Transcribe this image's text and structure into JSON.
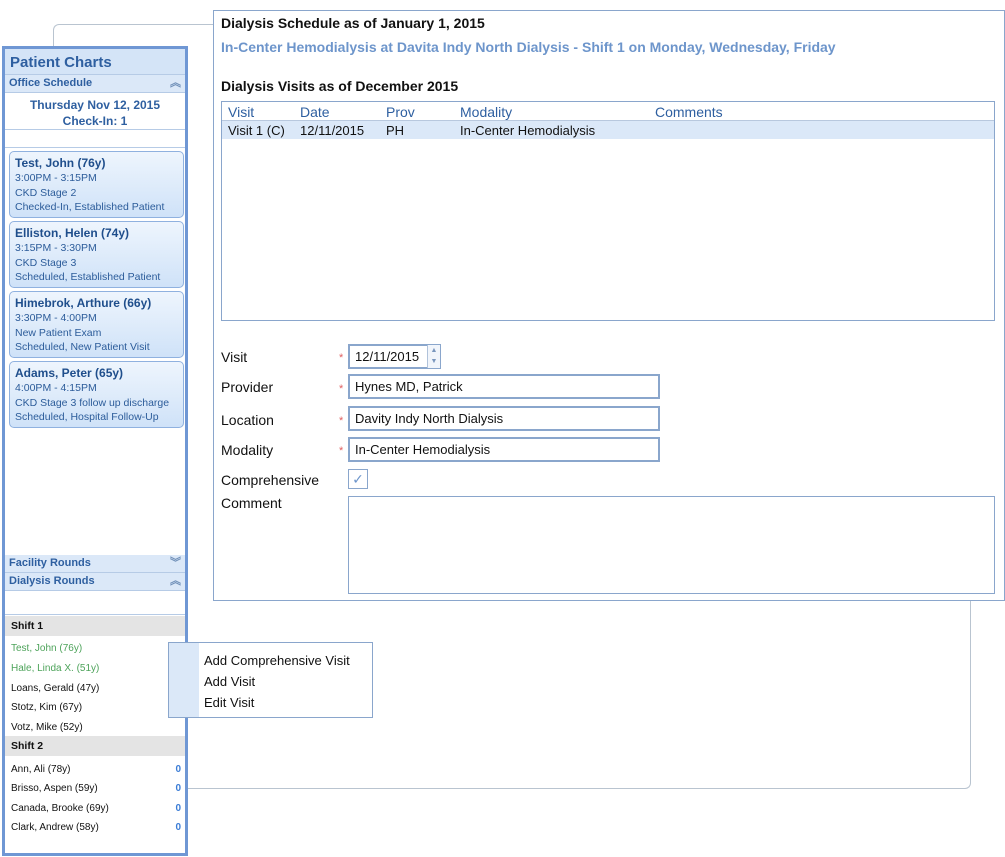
{
  "left": {
    "title": "Patient Charts",
    "office_schedule": "Office Schedule",
    "date": "Thursday Nov 12, 2015",
    "checkin": "Check-In: 1",
    "cards": [
      {
        "name": "Test, John (76y)",
        "time": "3:00PM - 3:15PM",
        "reason": "CKD Stage 2",
        "status": "Checked-In, Established Patient"
      },
      {
        "name": "Elliston, Helen (74y)",
        "time": "3:15PM - 3:30PM",
        "reason": "CKD Stage 3",
        "status": "Scheduled, Established Patient"
      },
      {
        "name": "Himebrok, Arthure (66y)",
        "time": "3:30PM - 4:00PM",
        "reason": "New Patient Exam",
        "status": "Scheduled, New Patient Visit"
      },
      {
        "name": "Adams, Peter (65y)",
        "time": "4:00PM - 4:15PM",
        "reason": "CKD Stage 3 follow up discharge",
        "status": "Scheduled, Hospital Follow-Up"
      }
    ],
    "facility_rounds": "Facility Rounds",
    "dialysis_rounds": "Dialysis Rounds",
    "shift1": "Shift 1",
    "shift1_patients": [
      "Test, John (76y)",
      "Hale, Linda X. (51y)",
      "Loans, Gerald (47y)",
      "Stotz, Kim (67y)",
      "Votz, Mike (52y)"
    ],
    "shift2": "Shift 2",
    "shift2_patients": [
      {
        "name": "Ann, Ali (78y)",
        "count": "0"
      },
      {
        "name": "Brisso, Aspen (59y)",
        "count": "0"
      },
      {
        "name": "Canada, Brooke (69y)",
        "count": "0"
      },
      {
        "name": "Clark, Andrew (58y)",
        "count": "0"
      }
    ]
  },
  "main": {
    "title": "Dialysis Schedule as of January 1, 2015",
    "subtitle": "In-Center Hemodialysis at Davita Indy North Dialysis - Shift 1 on Monday, Wednesday, Friday",
    "visits_title": "Dialysis Visits as of December  2015",
    "columns": {
      "visit": "Visit",
      "date": "Date",
      "prov": "Prov",
      "modality": "Modality",
      "comments": "Comments"
    },
    "row": {
      "visit": "Visit 1 (C)",
      "date": "12/11/2015",
      "prov": "PH",
      "modality": "In-Center Hemodialysis",
      "comments": ""
    },
    "form": {
      "visit_label": "Visit",
      "visit_value": "12/11/2015",
      "provider_label": "Provider",
      "provider_value": "Hynes MD, Patrick",
      "location_label": "Location",
      "location_value": "Davity Indy North Dialysis",
      "modality_label": "Modality",
      "modality_value": "In-Center Hemodialysis",
      "comprehensive_label": "Comprehensive",
      "comment_label": "Comment",
      "required_mark": "*"
    }
  },
  "context_menu": [
    "Add Comprehensive Visit",
    "Add Visit",
    "Edit Visit"
  ]
}
